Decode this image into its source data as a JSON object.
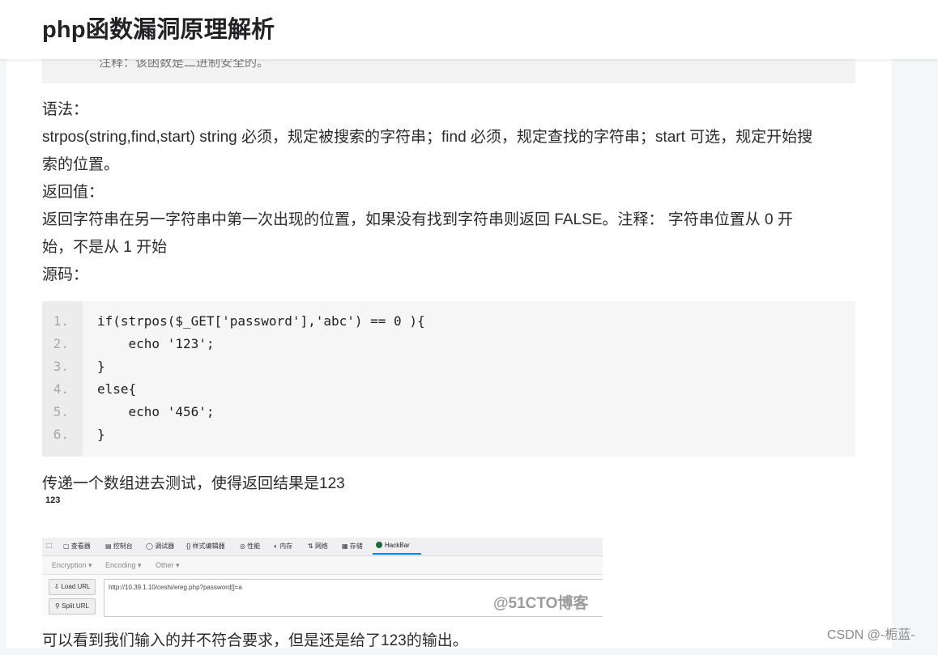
{
  "header": {
    "title": "php函数漏洞原理解析"
  },
  "note": {
    "text": "注释：该函数是二进制安全的。"
  },
  "paragraphs": {
    "syntax_label": "语法：",
    "syntax_line1": "strpos(string,find,start) string 必须，规定被搜索的字符串；find 必须，规定查找的字符串；start 可选，规定开始搜",
    "syntax_line2": "索的位置。",
    "return_label": "返回值：",
    "return_line1": "返回字符串在另一字符串中第一次出现的位置，如果没有找到字符串则返回 FALSE。注释： 字符串位置从 0 开",
    "return_line2": "始，不是从 1 开始",
    "source_label": "源码："
  },
  "code": {
    "lines": [
      {
        "num": "1.",
        "text": "if(strpos($_GET['password'],'abc') == 0 ){"
      },
      {
        "num": "2.",
        "text": "    echo '123';"
      },
      {
        "num": "3.",
        "text": "}"
      },
      {
        "num": "4.",
        "text": "else{"
      },
      {
        "num": "5.",
        "text": "    echo '456';"
      },
      {
        "num": "6.",
        "text": "}"
      }
    ]
  },
  "after_code": {
    "text": "传递一个数组进去测试，使得返回结果是123",
    "output": "123",
    "conclusion": "可以看到我们输入的并不符合要求，但是还是给了123的输出。"
  },
  "screenshot": {
    "tabs": [
      "查看器",
      "控制台",
      "调试器",
      "样式编辑器",
      "性能",
      "内存",
      "网络",
      "存储",
      "HackBar"
    ],
    "menus": [
      "Encryption ▾",
      "Encoding ▾",
      "Other ▾"
    ],
    "buttons": [
      "Load URL",
      "Split URL"
    ],
    "url": "http://10.39.1.10/ceshi/ereg.php?password[]=a",
    "watermark": "@51CTO博客",
    "hackbar_color": "#1e6b3b"
  },
  "footer": {
    "watermark": "CSDN @-栀蓝-"
  }
}
